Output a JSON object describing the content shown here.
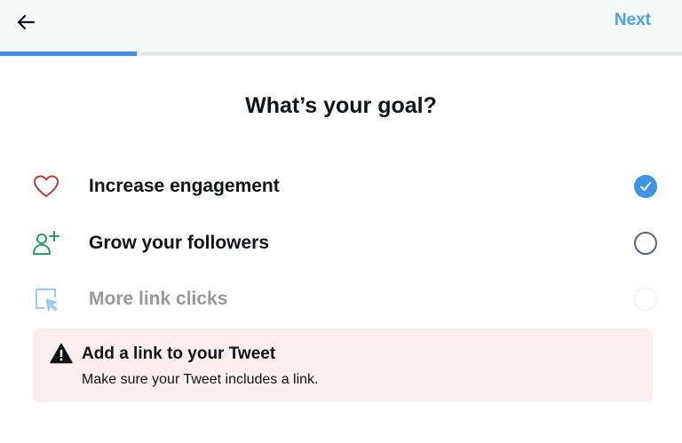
{
  "header": {
    "back_icon": "arrow-left-icon",
    "next_label": "Next",
    "next_color": "#4aa1e8"
  },
  "progress": {
    "fraction": 0.2,
    "color": "#3f95e3"
  },
  "main": {
    "title": "What’s your goal?",
    "options": [
      {
        "label": "Increase engagement",
        "icon": "heart-icon",
        "state": "selected"
      },
      {
        "label": "Grow your followers",
        "icon": "add-user-icon",
        "state": "unselected"
      },
      {
        "label": "More link clicks",
        "icon": "cursor-click-icon",
        "state": "disabled"
      }
    ]
  },
  "warning": {
    "icon": "warning-icon",
    "title": "Add a link to your Tweet",
    "message": "Make sure your Tweet includes a link.",
    "background": "#fbeeee"
  }
}
